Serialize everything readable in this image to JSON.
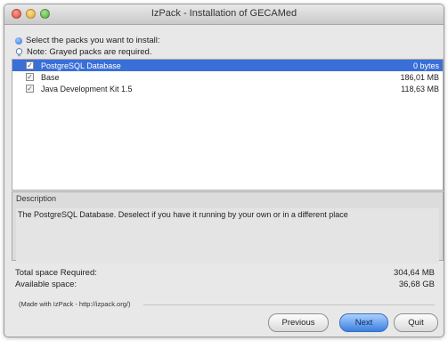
{
  "window": {
    "title": "IzPack - Installation of GECAMed"
  },
  "hints": {
    "select": "Select the packs you want to install:",
    "note": "Note: Grayed packs are required."
  },
  "packs": [
    {
      "name": "PostgreSQL Database",
      "size": "0 bytes",
      "checked": true,
      "selected": true
    },
    {
      "name": "Base",
      "size": "186,01 MB",
      "checked": true,
      "selected": false
    },
    {
      "name": "Java Development Kit 1.5",
      "size": "118,63 MB",
      "checked": true,
      "selected": false
    }
  ],
  "description": {
    "label": "Description",
    "text": "The PostgreSQL Database. Deselect if you have it running by your own or in a different place"
  },
  "space": {
    "required_label": "Total space Required:",
    "required_value": "304,64 MB",
    "available_label": "Available space:",
    "available_value": "36,68 GB"
  },
  "footer": {
    "made_with": "(Made with IzPack - http://izpack.org/)"
  },
  "buttons": {
    "previous": "Previous",
    "next": "Next",
    "quit": "Quit"
  },
  "icons": {
    "info": "info-dot-icon",
    "note": "bulb-icon",
    "check": "checkmark-icon"
  },
  "colors": {
    "selection": "#3a6fd8",
    "default_button": "#3b7fe0"
  }
}
